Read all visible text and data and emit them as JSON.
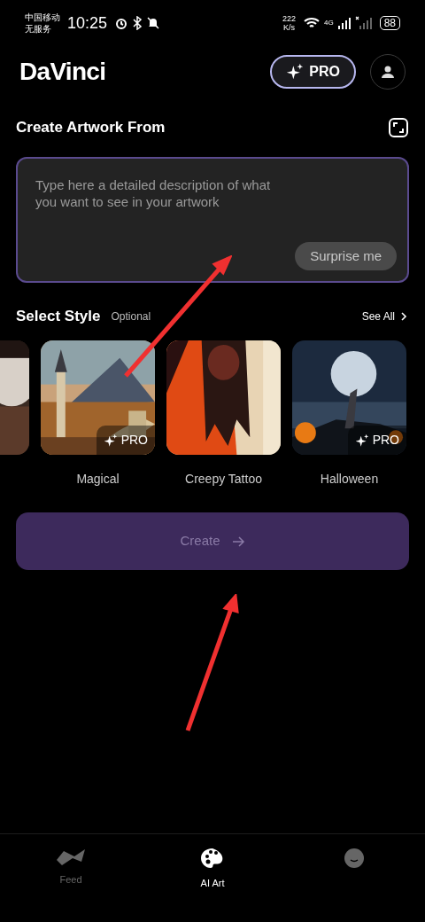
{
  "status_bar": {
    "carrier": "中国移动",
    "service": "无服务",
    "time": "10:25",
    "speed": "222",
    "speed_unit": "K/s",
    "network": "4G",
    "battery": "88"
  },
  "header": {
    "logo": "DaVinci",
    "pro_button": "PRO"
  },
  "prompt": {
    "title": "Create Artwork From",
    "placeholder": "Type here a detailed description of what you want to see in your artwork",
    "surprise_button": "Surprise me"
  },
  "styles_section": {
    "title": "Select Style",
    "hint": "Optional",
    "see_all": "See All"
  },
  "styles": [
    {
      "kind": "picture"
    },
    {
      "kind": "picture",
      "name": "Magical",
      "badge": "PRO",
      "pro": true
    },
    {
      "kind": "picture",
      "name": "Creepy Tattoo",
      "pro": false
    },
    {
      "kind": "picture",
      "name": "Halloween",
      "badge": "PRO",
      "pro": true
    }
  ],
  "create_button": {
    "label": "Create",
    "disabled": true
  },
  "bottom_nav": [
    {
      "label": "Feed",
      "selected": false
    },
    {
      "label": "AI Art",
      "selected": true
    },
    {
      "selected": false
    }
  ]
}
